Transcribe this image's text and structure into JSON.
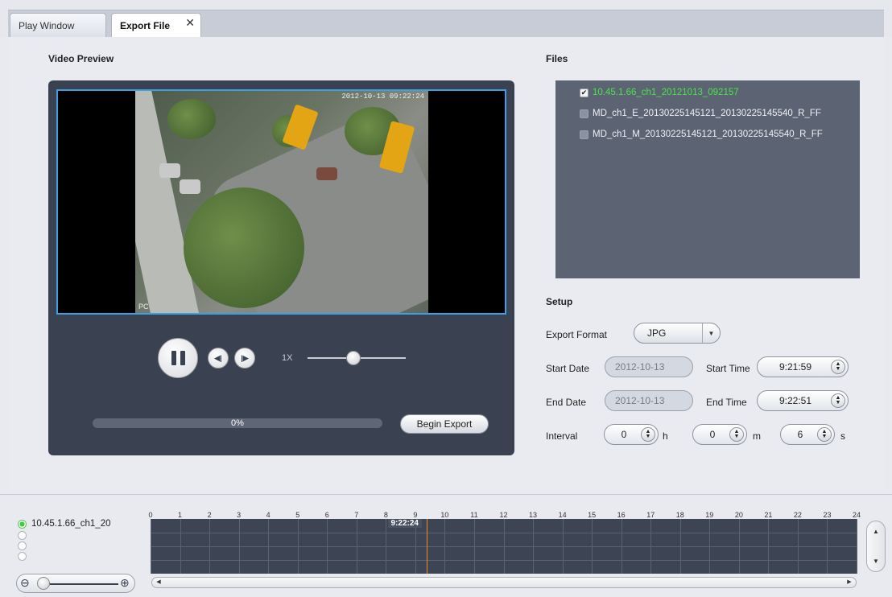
{
  "tabs": [
    {
      "label": "Play Window",
      "active": false
    },
    {
      "label": "Export File",
      "active": true,
      "close": "✕"
    }
  ],
  "preview": {
    "title": "Video Preview",
    "osd_time": "2012-10-13 09:22:24",
    "osd_label": "PC",
    "speed": "1X",
    "progress_percent": 0,
    "progress_text": "0%",
    "export_button": "Begin Export"
  },
  "files": {
    "title": "Files",
    "items": [
      {
        "name": "10.45.1.66_ch1_20121013_092157",
        "checked": true
      },
      {
        "name": "MD_ch1_E_20130225145121_20130225145540_R_FF",
        "checked": false
      },
      {
        "name": "MD_ch1_M_20130225145121_20130225145540_R_FF",
        "checked": false
      }
    ]
  },
  "setup": {
    "title": "Setup",
    "export_format_label": "Export Format",
    "export_format_value": "JPG",
    "start_date_label": "Start Date",
    "start_date_value": "2012-10-13",
    "start_time_label": "Start Time",
    "start_time_value": "9:21:59",
    "end_date_label": "End Date",
    "end_date_value": "2012-10-13",
    "end_time_label": "End Time",
    "end_time_value": "9:22:51",
    "interval_label": "Interval",
    "interval_h": "0",
    "interval_m": "0",
    "interval_s": "6",
    "unit_h": "h",
    "unit_m": "m",
    "unit_s": "s"
  },
  "timeline": {
    "channel_label": "10.45.1.66_ch1_20",
    "hours": [
      "0",
      "1",
      "2",
      "3",
      "4",
      "5",
      "6",
      "7",
      "8",
      "9",
      "10",
      "11",
      "12",
      "13",
      "14",
      "15",
      "16",
      "17",
      "18",
      "19",
      "20",
      "21",
      "22",
      "23",
      "24"
    ],
    "cursor_time": "9:22:24",
    "cursor_hour": 9.373
  },
  "icons": {
    "close": "close-icon",
    "pause": "pause-icon",
    "step_back": "step-back-icon",
    "step_forward": "step-forward-icon",
    "zoom_out": "zoom-out-icon",
    "zoom_in": "zoom-in-icon"
  },
  "colors": {
    "panel": "#3a4151",
    "files_panel": "#5c6474",
    "selected_file": "#4be34b",
    "frame_border": "#3ea0e4",
    "timeline_cursor": "#f08a1e"
  }
}
